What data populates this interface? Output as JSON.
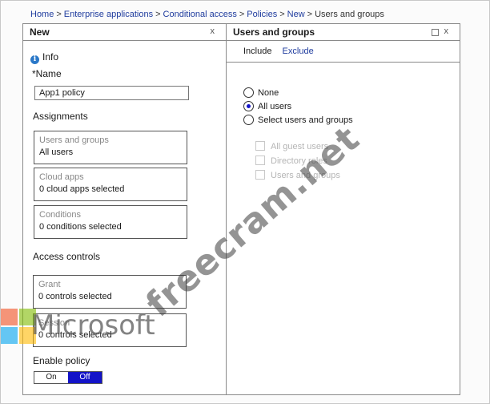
{
  "breadcrumb": {
    "items": [
      "Home",
      "Enterprise applications",
      "Conditional access",
      "Policies",
      "New"
    ],
    "current": "Users and groups",
    "separator": ">"
  },
  "new_blade": {
    "title": "New",
    "close": "x",
    "info": "Info",
    "name_label": "*Name",
    "name_value": "App1 policy",
    "assignments_label": "Assignments",
    "cards": [
      {
        "title": "Users and groups",
        "value": "All users"
      },
      {
        "title": "Cloud apps",
        "value": "0 cloud apps selected"
      },
      {
        "title": "Conditions",
        "value": "0 conditions selected"
      }
    ],
    "access_controls_label": "Access controls",
    "controls": [
      {
        "title": "Grant",
        "value": "0 controls selected"
      },
      {
        "title": "Session",
        "value": "0 controls selected"
      }
    ],
    "enable_policy_label": "Enable policy",
    "toggle": {
      "on": "On",
      "off": "Off",
      "selected": "Off"
    }
  },
  "users_blade": {
    "title": "Users and groups",
    "close": "x",
    "tabs": {
      "include": "Include",
      "exclude": "Exclude"
    },
    "radios": [
      {
        "label": "None",
        "selected": false
      },
      {
        "label": "All users",
        "selected": true
      },
      {
        "label": "Select users and groups",
        "selected": false
      }
    ],
    "checkboxes": [
      "All guest users",
      "Directory roles",
      "Users and groups"
    ]
  },
  "watermark": {
    "text": "freecram.net",
    "logo_text": "Microsoft"
  },
  "colors": {
    "link": "#1f3c9e",
    "accent": "#1313c8",
    "info": "#2a78c8"
  },
  "icons": [
    "info-icon",
    "close-icon",
    "maximize-icon"
  ]
}
